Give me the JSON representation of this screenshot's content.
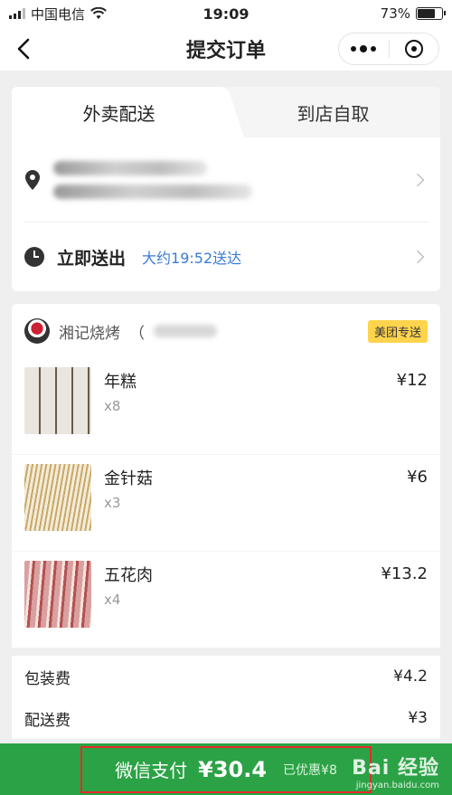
{
  "status_bar": {
    "carrier": "中国电信",
    "time": "19:09",
    "battery": "73%",
    "battery_level": 0.73
  },
  "nav": {
    "title": "提交订单"
  },
  "tabs": [
    {
      "label": "外卖配送",
      "active": true
    },
    {
      "label": "到店自取",
      "active": false
    }
  ],
  "delivery": {
    "time_label": "立即送出",
    "time_estimate": "大约19:52送达"
  },
  "shop": {
    "name": "湘记烧烤",
    "name_suffix": "（",
    "badge": "美团专送"
  },
  "items": [
    {
      "name": "年糕",
      "qty": "x8",
      "price": "¥12"
    },
    {
      "name": "金针菇",
      "qty": "x3",
      "price": "¥6"
    },
    {
      "name": "五花肉",
      "qty": "x4",
      "price": "¥13.2"
    }
  ],
  "fees": [
    {
      "label": "包装费",
      "value": "¥4.2"
    },
    {
      "label": "配送费",
      "value": "¥3"
    }
  ],
  "pay": {
    "label": "微信支付",
    "amount": "¥30.4",
    "discount": "已优惠¥8"
  },
  "watermark": {
    "main": "Bai 经验",
    "sub": "jingyan.baidu.com"
  },
  "colors": {
    "pay_green": "#2ba245",
    "link_blue": "#3a7bd5",
    "badge_yellow": "#ffd44d",
    "highlight_red": "#e52b2b"
  }
}
